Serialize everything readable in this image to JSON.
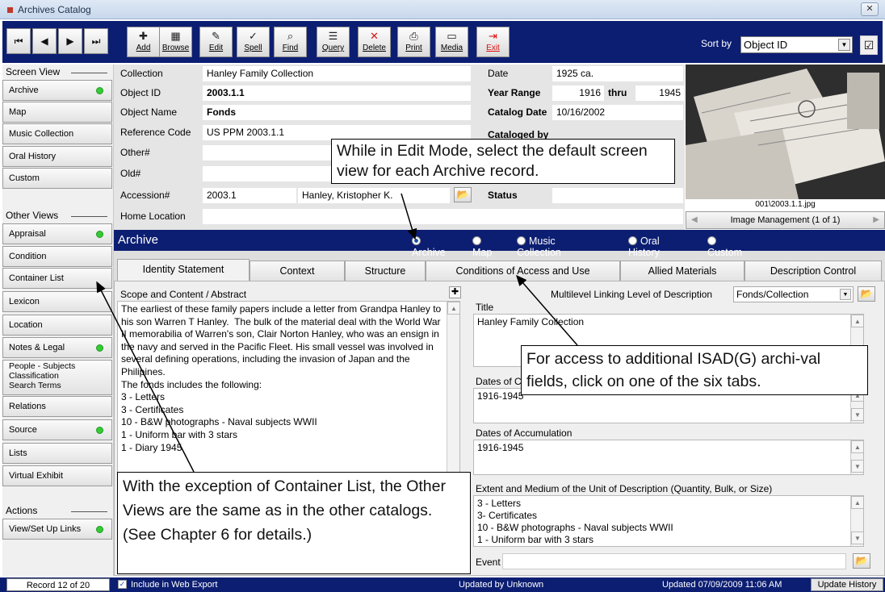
{
  "window": {
    "title": "Archives Catalog",
    "close_glyph": "✕"
  },
  "toolbar": {
    "nav": [
      {
        "name": "first-record-button",
        "glyph": "⏮"
      },
      {
        "name": "prev-record-button",
        "glyph": "◀"
      },
      {
        "name": "next-record-button",
        "glyph": "▶"
      },
      {
        "name": "last-record-button",
        "glyph": "⏭"
      }
    ],
    "buttons": [
      {
        "id": "add",
        "label": "Add",
        "glyph": "✚"
      },
      {
        "id": "browse",
        "label": "Browse",
        "glyph": "▦"
      },
      {
        "id": "edit",
        "label": "Edit",
        "glyph": "✎"
      },
      {
        "id": "spell",
        "label": "Spell",
        "glyph": "✓"
      },
      {
        "id": "find",
        "label": "Find",
        "glyph": "⌕"
      },
      {
        "id": "query",
        "label": "Query",
        "glyph": "☰"
      },
      {
        "id": "delete",
        "label": "Delete",
        "glyph": "✕"
      },
      {
        "id": "print",
        "label": "Print",
        "glyph": "⎙"
      },
      {
        "id": "media",
        "label": "Media",
        "glyph": "▭"
      },
      {
        "id": "exit",
        "label": "Exit",
        "glyph": "⇥"
      }
    ],
    "sort_label": "Sort by",
    "sort_value": "Object ID",
    "dropdown_glyph": "▼",
    "clipboard_glyph": "☑"
  },
  "left_panel": {
    "screen_view_header": "Screen View",
    "screen_views": [
      {
        "label": "Archive",
        "dot": true
      },
      {
        "label": "Map",
        "dot": false
      },
      {
        "label": "Music Collection",
        "dot": false
      },
      {
        "label": "Oral History",
        "dot": false
      },
      {
        "label": "Custom",
        "dot": false
      }
    ],
    "other_views_header": "Other Views",
    "other_views": [
      {
        "label": "Appraisal",
        "dot": true
      },
      {
        "label": "Condition",
        "dot": false
      },
      {
        "label": "Container List",
        "dot": false
      },
      {
        "label": "Lexicon",
        "dot": false
      },
      {
        "label": "Location",
        "dot": false
      },
      {
        "label": "Notes & Legal",
        "dot": true
      },
      {
        "label": "People - Subjects\nClassification\nSearch Terms",
        "dot": false
      },
      {
        "label": "Relations",
        "dot": false
      },
      {
        "label": "Source",
        "dot": true
      },
      {
        "label": "Lists",
        "dot": false
      },
      {
        "label": "Virtual Exhibit",
        "dot": false
      }
    ],
    "actions_header": "Actions",
    "actions": [
      {
        "label": "View/Set Up Links",
        "dot": true
      }
    ]
  },
  "fields": {
    "collection_label": "Collection",
    "collection": "Hanley Family Collection",
    "object_id_label": "Object ID",
    "object_id": "2003.1.1",
    "object_name_label": "Object Name",
    "object_name": "Fonds",
    "reference_code_label": "Reference Code",
    "reference_code": "US PPM 2003.1.1",
    "other_num_label": "Other#",
    "old_num_label": "Old#",
    "accession_label": "Accession#",
    "accession": "2003.1",
    "accession_name": "Hanley, Kristopher K.",
    "home_location_label": "Home Location",
    "date_label": "Date",
    "date": "1925 ca.",
    "year_range_label": "Year Range",
    "year_from": "1916",
    "thru_label": "thru",
    "year_to": "1945",
    "catalog_date_label": "Catalog Date",
    "catalog_date": "10/16/2002",
    "cataloged_by_label": "Cataloged by",
    "status_label": "Status",
    "folder_glyph": "📂"
  },
  "image": {
    "caption": "001\\2003.1.1.jpg",
    "management": "Image Management (1 of 1)",
    "left_glyph": "◀",
    "right_glyph": "▶"
  },
  "archive_bar": {
    "title": "Archive",
    "options": [
      {
        "label": "Archive",
        "selected": true
      },
      {
        "label": "Map",
        "selected": false
      },
      {
        "label": "Music Collection",
        "selected": false
      },
      {
        "label": "Oral History",
        "selected": false
      },
      {
        "label": "Custom",
        "selected": false
      }
    ]
  },
  "tabs": [
    "Identity Statement",
    "Context",
    "Structure",
    "Conditions of Access and Use",
    "Allied Materials",
    "Description Control"
  ],
  "identity": {
    "scope_label": "Scope and Content / Abstract",
    "plus_glyph": "✚",
    "scope_text": "The earliest of these family papers include a letter from Grandpa Hanley to his son Warren T Hanley.  The bulk of the material deal with the World War II memorabilia of Warren's son, Clair Norton Hanley, who was an ensign in the navy and served in the Pacific Fleet. His small vessel was involved in several defining operations, including the invasion of Japan and the Philipines.\nThe fonds includes the following:\n3 - Letters\n3 - Certificates\n10 - B&W photographs - Naval subjects WWII\n1 - Uniform bar with 3 stars\n1 - Diary 1945",
    "multilevel_label": "Multilevel Linking Level of Description",
    "multilevel_value": "Fonds/Collection",
    "title_label": "Title",
    "title_value": "Hanley Family Collection",
    "dates_creation_label": "Dates of C",
    "dates_creation_value": "1916-1945",
    "dates_accum_label": "Dates of Accumulation",
    "dates_accum_value": "1916-1945",
    "extent_label": "Extent and Medium of the Unit of Description (Quantity, Bulk, or Size)",
    "extent_value": "3 - Letters\n3- Certificates\n10 - B&W photographs - Naval subjects WWII\n1 - Uniform bar with 3 stars",
    "event_label": "Event"
  },
  "status": {
    "record": "Record 12 of 20",
    "web_export": "Include in Web Export",
    "updated_by": "Updated by  Unknown",
    "updated": "Updated   07/09/2009 11:06 AM",
    "update_history": "Update History"
  },
  "callouts": {
    "edit_mode": "While in Edit Mode, select the default screen view for each Archive record.",
    "isad": "For access to additional ISAD(G) archi-val fields, click on one of the six tabs.",
    "other_views": "With the exception of Container List, the Other Views are the same as in the other catalogs. (See Chapter 6 for details.)"
  }
}
